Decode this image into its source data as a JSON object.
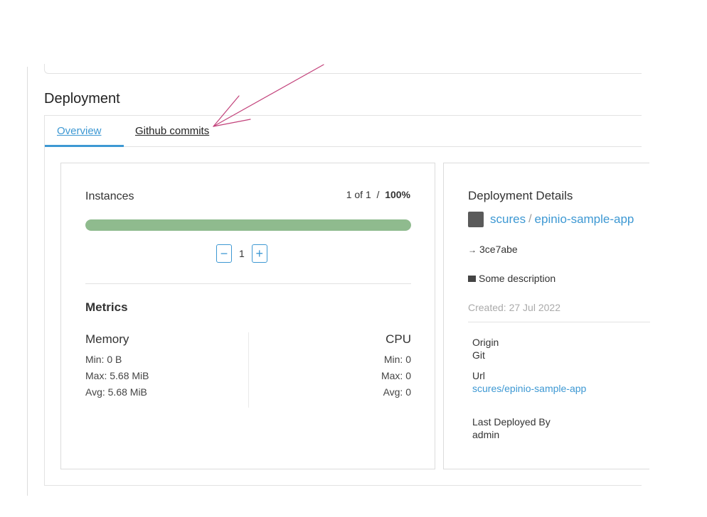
{
  "section": {
    "title": "Deployment"
  },
  "tabs": [
    {
      "label": "Overview",
      "active": true
    },
    {
      "label": "Github commits",
      "active": false
    }
  ],
  "instances": {
    "label": "Instances",
    "count_text": "1 of 1",
    "separator": "/",
    "percent_text": "100%",
    "progress_fraction": 1.0,
    "progress_color": "#8fbb8e",
    "stepper_value": "1",
    "decrement_label": "−",
    "increment_label": "+"
  },
  "metrics": {
    "title": "Metrics",
    "memory": {
      "heading": "Memory",
      "min": "Min: 0 B",
      "max": "Max: 5.68 MiB",
      "avg": "Avg: 5.68 MiB"
    },
    "cpu": {
      "heading": "CPU",
      "min": "Min: 0",
      "max": "Max: 0",
      "avg": "Avg: 0"
    }
  },
  "deployment_details": {
    "title": "Deployment Details",
    "repo_owner": "scures",
    "repo_separator": "/",
    "repo_name": "epinio-sample-app",
    "commit_icon": "→",
    "commit_hash": "3ce7abe",
    "description": "Some description",
    "created": "Created: 27 Jul 2022",
    "origin_label": "Origin",
    "origin_value": "Git",
    "url_label": "Url",
    "url_value": "scures/epinio-sample-app",
    "deployed_by_label": "Last Deployed By",
    "deployed_by_value": "admin"
  },
  "colors": {
    "accent": "#3d98d3",
    "annotation": "#c2417a"
  }
}
